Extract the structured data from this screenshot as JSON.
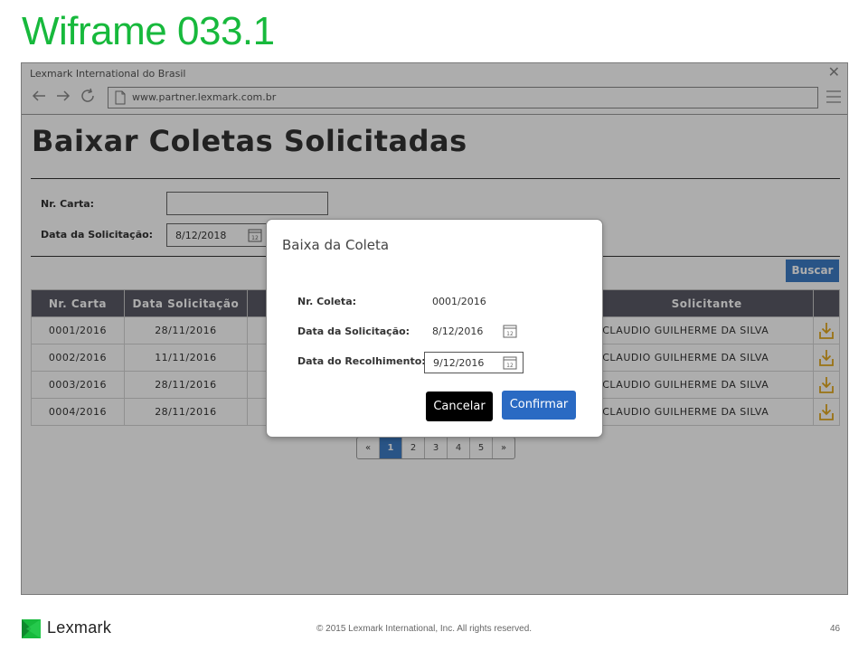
{
  "slide": {
    "title": "Wiframe 033.1"
  },
  "browser": {
    "window_title": "Lexmark International do Brasil",
    "url": "www.partner.lexmark.com.br"
  },
  "page": {
    "title": "Baixar Coletas Solicitadas",
    "filters": {
      "nr_carta_label": "Nr. Carta:",
      "nr_carta_value": "",
      "data_solicitacao_label": "Data da Solicitação:",
      "data_solicitacao_value": "8/12/2018"
    },
    "search_button": "Buscar",
    "table": {
      "headers": [
        "Nr. Carta",
        "Data Solicitação",
        "",
        "",
        "Solicitante",
        ""
      ],
      "rows": [
        {
          "nr_carta": "0001/2016",
          "data": "28/11/2016",
          "solicitante": "CLAUDIO GUILHERME DA SILVA"
        },
        {
          "nr_carta": "0002/2016",
          "data": "11/11/2016",
          "solicitante": "CLAUDIO GUILHERME DA SILVA"
        },
        {
          "nr_carta": "0003/2016",
          "data": "28/11/2016",
          "solicitante": "CLAUDIO GUILHERME DA SILVA"
        },
        {
          "nr_carta": "0004/2016",
          "data": "28/11/2016",
          "solicitante": "CLAUDIO GUILHERME DA SILVA"
        }
      ]
    },
    "pagination": {
      "prev": "«",
      "pages": [
        "1",
        "2",
        "3",
        "4",
        "5"
      ],
      "next": "»",
      "active_page": "1"
    }
  },
  "modal": {
    "title": "Baixa da Coleta",
    "nr_coleta_label": "Nr. Coleta:",
    "nr_coleta_value": "0001/2016",
    "data_solicitacao_label": "Data da Solicitação:",
    "data_solicitacao_value": "8/12/2016",
    "data_recolhimento_label": "Data do Recolhimento: *",
    "data_recolhimento_value": "9/12/2016",
    "cancel_label": "Cancelar",
    "confirm_label": "Confirmar"
  },
  "footer": {
    "brand": "Lexmark",
    "copyright": "© 2015 Lexmark International, Inc. All rights reserved.",
    "page_number": "46"
  },
  "colors": {
    "slide_title": "#17b93c",
    "primary_button": "#2a6ac3",
    "table_header": "#5a5a66",
    "download_icon": "#e3a91e"
  },
  "icons": {
    "back": "arrow-left-icon",
    "forward": "arrow-right-icon",
    "refresh": "refresh-icon",
    "page": "document-icon",
    "menu": "hamburger-menu-icon",
    "close": "close-icon",
    "calendar": "calendar-icon",
    "download": "download-icon",
    "brand_logo": "lexmark-logo-icon"
  }
}
